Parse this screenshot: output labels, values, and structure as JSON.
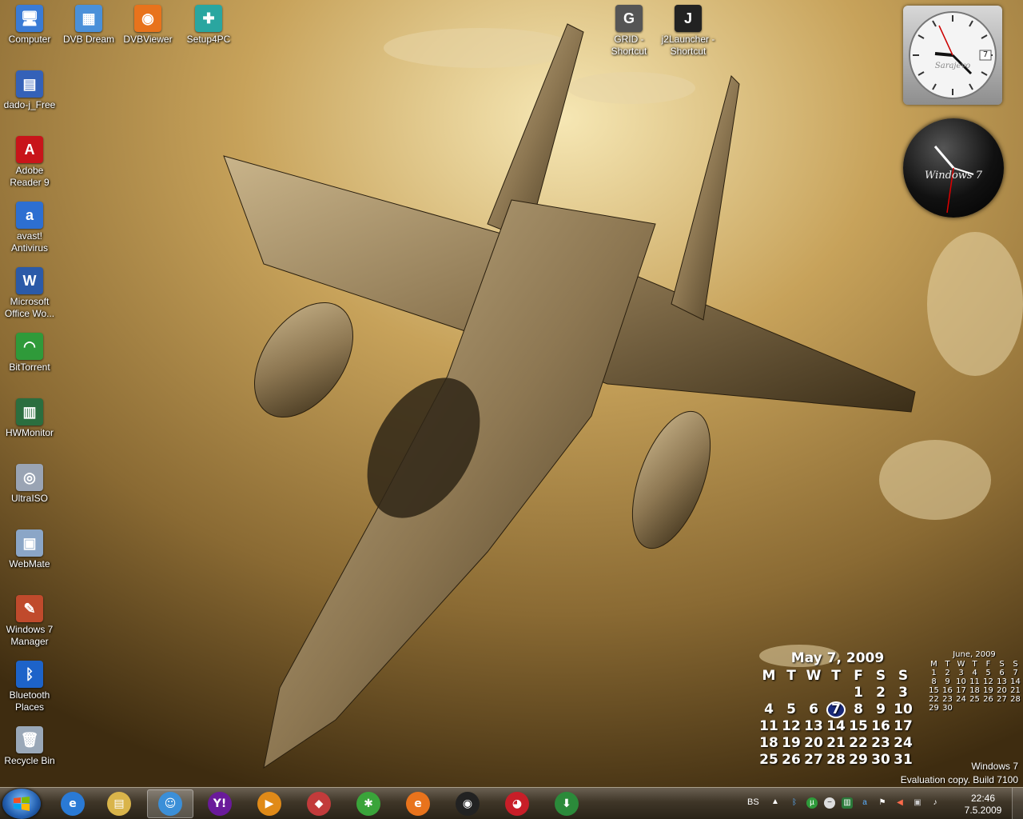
{
  "desktop_icons": [
    {
      "label": "Computer",
      "icon": "computer-icon",
      "color": "#3a7bd5",
      "glyph": "🖥"
    },
    {
      "label": "DVB Dream",
      "icon": "dvb-dream-icon",
      "color": "#4a90d9",
      "glyph": "▦"
    },
    {
      "label": "DVBViewer",
      "icon": "dvbviewer-icon",
      "color": "#e8731c",
      "glyph": "◉"
    },
    {
      "label": "Setup4PC",
      "icon": "setup4pc-icon",
      "color": "#2aa6a0",
      "glyph": "✚"
    },
    {
      "label": "dado-j_Free",
      "icon": "dado-j-icon",
      "color": "#3461b8",
      "glyph": "▤"
    },
    {
      "label": "Adobe Reader 9",
      "icon": "adobe-reader-icon",
      "color": "#c8141a",
      "glyph": "A"
    },
    {
      "label": "avast! Antivirus",
      "icon": "avast-icon",
      "color": "#2d6fd1",
      "glyph": "a"
    },
    {
      "label": "Microsoft Office Wo...",
      "icon": "word-icon",
      "color": "#2b5aa8",
      "glyph": "W"
    },
    {
      "label": "BitTorrent",
      "icon": "bittorrent-icon",
      "color": "#2f9a3a",
      "glyph": "◠"
    },
    {
      "label": "HWMonitor",
      "icon": "hwmonitor-icon",
      "color": "#2b6e3f",
      "glyph": "▥"
    },
    {
      "label": "UltraISO",
      "icon": "ultraiso-icon",
      "color": "#9aa4b4",
      "glyph": "◎"
    },
    {
      "label": "WebMate",
      "icon": "webmate-icon",
      "color": "#8ba6c7",
      "glyph": "▣"
    },
    {
      "label": "Windows 7 Manager",
      "icon": "windows7-manager-icon",
      "color": "#c04a2c",
      "glyph": "✎"
    },
    {
      "label": "Bluetooth Places",
      "icon": "bluetooth-icon",
      "color": "#1d63c9",
      "glyph": "ᛒ"
    },
    {
      "label": "Recycle Bin",
      "icon": "recycle-bin-icon",
      "color": "#9aa8b8",
      "glyph": "🗑"
    },
    {
      "label": "GRID - Shortcut",
      "icon": "grid-icon",
      "color": "#555555",
      "glyph": "G"
    },
    {
      "label": "j2Launcher - Shortcut",
      "icon": "j2launcher-icon",
      "color": "#222222",
      "glyph": "J"
    }
  ],
  "clock_gadget_1": {
    "city": "Sarajevo",
    "date": "7"
  },
  "clock_gadget_2": {
    "brand": "Windows 7"
  },
  "calendar_main": {
    "title": "May 7, 2009",
    "weekdays": [
      "M",
      "T",
      "W",
      "T",
      "F",
      "S",
      "S"
    ],
    "weeks": [
      [
        "",
        "",
        "",
        "",
        "1",
        "2",
        "3"
      ],
      [
        "4",
        "5",
        "6",
        "7",
        "8",
        "9",
        "10"
      ],
      [
        "11",
        "12",
        "13",
        "14",
        "15",
        "16",
        "17"
      ],
      [
        "18",
        "19",
        "20",
        "21",
        "22",
        "23",
        "24"
      ],
      [
        "25",
        "26",
        "27",
        "28",
        "29",
        "30",
        "31"
      ]
    ],
    "today": "7"
  },
  "calendar_small": {
    "title": "June, 2009",
    "weekdays": [
      "M",
      "T",
      "W",
      "T",
      "F",
      "S",
      "S"
    ],
    "weeks": [
      [
        "1",
        "2",
        "3",
        "4",
        "5",
        "6",
        "7"
      ],
      [
        "8",
        "9",
        "10",
        "11",
        "12",
        "13",
        "14"
      ],
      [
        "15",
        "16",
        "17",
        "18",
        "19",
        "20",
        "21"
      ],
      [
        "22",
        "23",
        "24",
        "25",
        "26",
        "27",
        "28"
      ],
      [
        "29",
        "30",
        "",
        "",
        "",
        "",
        ""
      ]
    ]
  },
  "watermark": {
    "line1": "Windows 7",
    "line2": "Evaluation copy. Build 7100"
  },
  "taskbar": {
    "apps": [
      {
        "name": "internet-explorer",
        "icon": "internet-explorer-icon",
        "color": "#2a7ad5",
        "glyph": "e"
      },
      {
        "name": "windows-explorer",
        "icon": "folder-icon",
        "color": "#d9b44a",
        "glyph": "▤"
      },
      {
        "name": "messenger",
        "icon": "messenger-icon",
        "color": "#3b8fd8",
        "glyph": "☺",
        "active": true
      },
      {
        "name": "yahoo-messenger",
        "icon": "yahoo-icon",
        "color": "#6a1a9a",
        "glyph": "Y!"
      },
      {
        "name": "media-player",
        "icon": "media-player-icon",
        "color": "#e08a18",
        "glyph": "▶"
      },
      {
        "name": "picasa",
        "icon": "picasa-icon",
        "color": "#c23b3b",
        "glyph": "◆"
      },
      {
        "name": "network-app",
        "icon": "network-icon",
        "color": "#3aa43a",
        "glyph": "✱"
      },
      {
        "name": "browser-e",
        "icon": "browser-e-icon",
        "color": "#e8731c",
        "glyph": "e"
      },
      {
        "name": "media-center",
        "icon": "eye-player-icon",
        "color": "#222222",
        "glyph": "◉"
      },
      {
        "name": "red-app",
        "icon": "red-app-icon",
        "color": "#c81e28",
        "glyph": "◕"
      },
      {
        "name": "download-app",
        "icon": "download-icon",
        "color": "#2b8a3a",
        "glyph": "⬇"
      }
    ],
    "tray": {
      "lang": "BS",
      "time": "22:46",
      "date": "7.5.2009"
    }
  }
}
